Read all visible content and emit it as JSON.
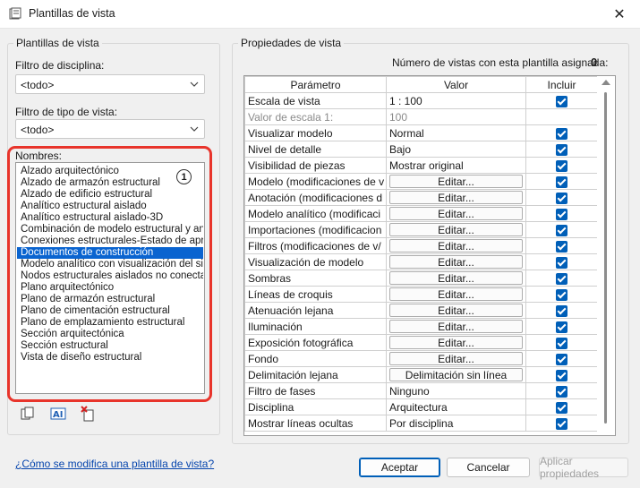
{
  "window": {
    "title": "Plantillas de vista",
    "close_glyph": "✕"
  },
  "left": {
    "group_title": "Plantillas de vista",
    "discipline_label": "Filtro de disciplina:",
    "discipline_value": "<todo>",
    "viewtype_label": "Filtro de tipo de vista:",
    "viewtype_value": "<todo>",
    "names_label": "Nombres:",
    "callout": "1",
    "names": [
      "Alzado arquitectónico",
      "Alzado de armazón estructural",
      "Alzado de edificio estructural",
      "Analítico estructural aislado",
      "Analítico estructural aislado-3D",
      "Combinación de modelo estructural y analít",
      "Conexiones estructurales-Estado de aprob",
      "Documentos de construcción",
      "Modelo analítico con visualización del sister",
      "Nodos estructurales aislados no conectado",
      "Plano arquitectónico",
      "Plano de armazón estructural",
      "Plano de cimentación estructural",
      "Plano de emplazamiento estructural",
      "Sección arquitectónica",
      "Sección estructural",
      "Vista de diseño estructural"
    ],
    "selected_index": 7
  },
  "right": {
    "group_title": "Propiedades de vista",
    "count_label": "Número de vistas con esta plantilla asignada:",
    "count_value": "0",
    "headers": {
      "param": "Parámetro",
      "value": "Valor",
      "include": "Incluir"
    },
    "rows": [
      {
        "param": "Escala de vista",
        "value": "1 : 100",
        "kind": "text",
        "include": true
      },
      {
        "param": "Valor de escala    1:",
        "value": "100",
        "kind": "muted",
        "include": null
      },
      {
        "param": "Visualizar modelo",
        "value": "Normal",
        "kind": "text",
        "include": true
      },
      {
        "param": "Nivel de detalle",
        "value": "Bajo",
        "kind": "text",
        "include": true
      },
      {
        "param": "Visibilidad de piezas",
        "value": "Mostrar original",
        "kind": "text",
        "include": true
      },
      {
        "param": "Modelo (modificaciones de v",
        "value": "Editar...",
        "kind": "button",
        "include": true
      },
      {
        "param": "Anotación (modificaciones d",
        "value": "Editar...",
        "kind": "button",
        "include": true
      },
      {
        "param": "Modelo analítico (modificaci",
        "value": "Editar...",
        "kind": "button",
        "include": true
      },
      {
        "param": "Importaciones (modificacion",
        "value": "Editar...",
        "kind": "button",
        "include": true
      },
      {
        "param": "Filtros (modificaciones de v/",
        "value": "Editar...",
        "kind": "button",
        "include": true
      },
      {
        "param": "Visualización de modelo",
        "value": "Editar...",
        "kind": "button",
        "include": true
      },
      {
        "param": "Sombras",
        "value": "Editar...",
        "kind": "button",
        "include": true
      },
      {
        "param": "Líneas de croquis",
        "value": "Editar...",
        "kind": "button",
        "include": true
      },
      {
        "param": "Atenuación lejana",
        "value": "Editar...",
        "kind": "button",
        "include": true
      },
      {
        "param": "Iluminación",
        "value": "Editar...",
        "kind": "button",
        "include": true
      },
      {
        "param": "Exposición fotográfica",
        "value": "Editar...",
        "kind": "button",
        "include": true
      },
      {
        "param": "Fondo",
        "value": "Editar...",
        "kind": "button",
        "include": true
      },
      {
        "param": "Delimitación lejana",
        "value": "Delimitación sin línea",
        "kind": "button",
        "include": true
      },
      {
        "param": "Filtro de fases",
        "value": "Ninguno",
        "kind": "text",
        "include": true
      },
      {
        "param": "Disciplina",
        "value": "Arquitectura",
        "kind": "text",
        "include": true
      },
      {
        "param": "Mostrar líneas ocultas",
        "value": "Por disciplina",
        "kind": "text",
        "include": true
      }
    ]
  },
  "footer": {
    "help_link": "¿Cómo se modifica una plantilla de vista?",
    "ok": "Aceptar",
    "cancel": "Cancelar",
    "apply": "Aplicar propiedades"
  },
  "colors": {
    "selection": "#0a64d0",
    "checkbox": "#005fb8",
    "callout_border": "#e8342b"
  }
}
